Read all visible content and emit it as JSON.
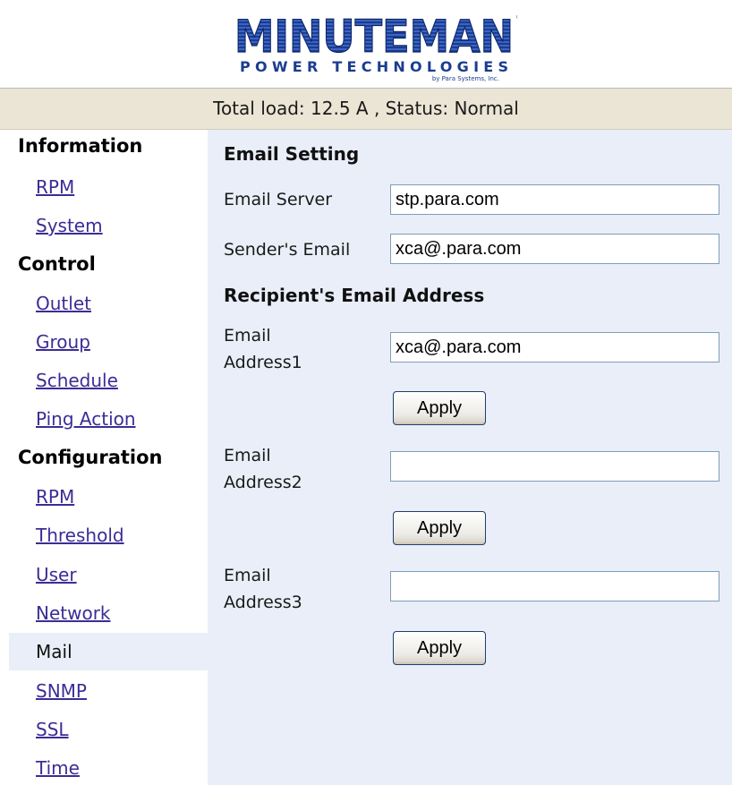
{
  "header": {
    "logo_main": "MINUTEMAN",
    "logo_sub": "POWER TECHNOLOGIES",
    "logo_tagline": "by Para Systems, Inc.",
    "status_text": "Total load: 12.5 A , Status: Normal"
  },
  "sidebar": {
    "information_heading": "Information",
    "information_items": [
      "RPM",
      "System"
    ],
    "control_heading": "Control",
    "control_items": [
      "Outlet",
      "Group",
      "Schedule",
      "Ping Action"
    ],
    "configuration_heading": "Configuration",
    "configuration_items": [
      "RPM",
      "Threshold",
      "User",
      "Network",
      "Mail",
      "SNMP",
      "SSL",
      "Time"
    ],
    "active_item": "Mail"
  },
  "main": {
    "email_setting_heading": "Email Setting",
    "email_server_label": "Email Server",
    "email_server_value": "stp.para.com",
    "sender_label": "Sender's Email",
    "sender_value": "xca@.para.com",
    "recipient_heading": "Recipient's Email Address",
    "address1_label_line1": "Email",
    "address1_label_line2": "Address1",
    "address1_value": "xca@.para.com",
    "address2_label_line1": "Email",
    "address2_label_line2": "Address2",
    "address2_value": "",
    "address3_label_line1": "Email",
    "address3_label_line2": "Address3",
    "address3_value": "",
    "apply_label": "Apply"
  },
  "colors": {
    "link": "#3b2d96",
    "status_bar_bg": "#ebe5d5",
    "content_bg": "#e9eef8",
    "logo_blue": "#1b3d8f"
  }
}
